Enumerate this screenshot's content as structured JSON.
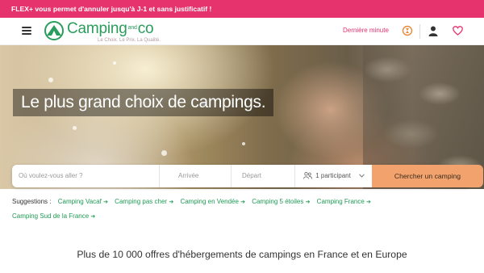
{
  "promo_banner": "FLEX+ vous permet d'annuler jusqu'à J-1 et sans justificatif !",
  "header": {
    "logo_main": "Camping",
    "logo_and": "and",
    "logo_co": "co",
    "tagline": "Le Choix. Le Prix. La Qualité.",
    "last_minute": "Dernière minute",
    "icons": [
      "menu-icon",
      "hourglass-icon",
      "user-icon",
      "heart-icon"
    ]
  },
  "hero": {
    "title": "Le plus grand choix de campings."
  },
  "search": {
    "destination_placeholder": "Où voulez-vous aller ?",
    "arrival_placeholder": "Arrivée",
    "departure_placeholder": "Départ",
    "participants": "1 participant",
    "button": "Chercher un camping"
  },
  "suggestions": {
    "label": "Suggestions :",
    "items": [
      "Camping Vacaf",
      "Camping pas cher",
      "Camping en Vendée",
      "Camping 5 étoiles",
      "Camping France",
      "Camping Sud de la France"
    ]
  },
  "offers_heading": "Plus de 10 000 offres d'hébergements de campings en France et en Europe",
  "colors": {
    "brand_pink": "#e6336e",
    "brand_green": "#2a9d5c",
    "button_orange": "#f2a36d",
    "link_green": "#1e9b55"
  }
}
